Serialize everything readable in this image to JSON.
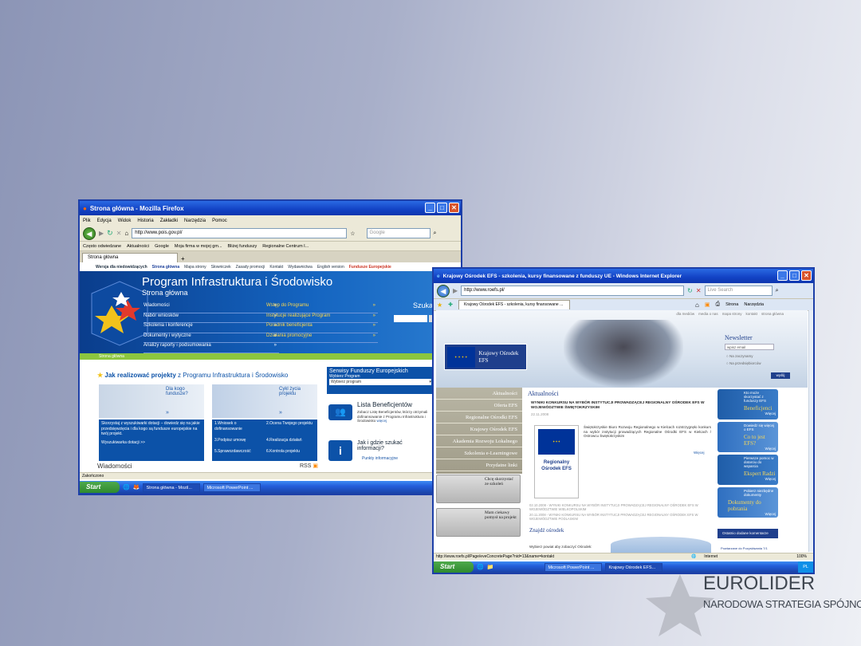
{
  "firefox": {
    "title": "Strona główna - Mozilla Firefox",
    "menu": [
      "Plik",
      "Edycja",
      "Widok",
      "Historia",
      "Zakładki",
      "Narzędzia",
      "Pomoc"
    ],
    "url": "http://www.pois.gov.pl/",
    "search_placeholder": "Google",
    "bookmarks": [
      "Często odwiedzane",
      "Aktualności",
      "Google",
      "Moja firma w mojej gm...",
      "Bliżej funduszy",
      "Regionalne Centrum I..."
    ],
    "tab": "Strona główna",
    "status": "Zakończono",
    "page": {
      "toplinks": [
        "Wersja dla niedowidzących",
        "Strona główna",
        "Mapa strony",
        "Słowniczek",
        "Zasady promocji",
        "Kontakt",
        "Wydawnictwa",
        "English version",
        "Fundusze Europejskie"
      ],
      "title": "Program Infrastruktura i Środowisko",
      "subtitle": "Strona główna",
      "menu_left": [
        "Wiadomości",
        "Nabór wniosków",
        "Szkolenia i konferencje",
        "Dokumenty i wytyczne",
        "Analizy raporty i podsumowania"
      ],
      "menu_right": [
        "Wstęp do Programu",
        "Instytucje realizujące Program",
        "Poradnik beneficjenta",
        "Działania promocyjne"
      ],
      "search_label": "Szukaj",
      "breadcrumb": "Strona główna",
      "howto_title": "Jak realizować projekty",
      "howto_suffix": "z Programu Infrastruktura i Środowisko",
      "card1_title": "Dla kogo fundusze?",
      "card2_title": "Cykl życia projektu",
      "card1_text": "Skorzystaj z wyszukiwarki dotacji – dowiedz się na jakie przedsięwzięcia i dla kogo są fundusze europejskie na twój projekt.",
      "card1_link": "Wyszukiwarka dotacji >>",
      "card2_steps": [
        "1.Wniosek o dofinansowanie",
        "2.Ocena Twojego projektu",
        "3.Podpisz umowę",
        "4.Realizacja działań",
        "5.Sprawozdawczość",
        "6.Kontrola projektu"
      ],
      "serwisy_title": "Serwisy Funduszy Europejskich",
      "serwisy_label": "Wybierz Program",
      "serwisy_select": "Wybierz program",
      "lista_title": "Lista Beneficjentów",
      "lista_text": "Zobacz Listę Beneficjentów, którzy otrzymali dofinansowanie z Programu Infrastruktura i Środowisko",
      "lista_more": "więcej",
      "info_title": "Jak i gdzie szukać informacji?",
      "info_link": "Punkty informacyjne",
      "news_label": "Wiadomości",
      "rss": "RSS"
    },
    "taskbar": {
      "start": "Start",
      "tasks": [
        "Strona główna - Mozil...",
        "Microsoft PowerPoint ..."
      ],
      "tray": "PL"
    }
  },
  "ie": {
    "title": "Krajowy Ośrodek EFS - szkolenia, kursy finansowane z funduszy UE - Windows Internet Explorer",
    "url": "http://www.roefs.pl/",
    "search_placeholder": "Live Search",
    "tab": "Krajowy Ośrodek EFS - szkolenia, kursy finansowane ...",
    "toolbar": [
      "Strona",
      "Narzędzia"
    ],
    "status_url": "http://www.roefs.pl/Page/eveConcretePage?nid=13&name=kontakt",
    "status_zone": "Internet",
    "zoom": "100%",
    "page": {
      "toplinks": [
        "dla mediów",
        "media o nas",
        "mapa strony",
        "kontakt",
        "strona główna"
      ],
      "logo": "Krajowy Ośrodek EFS",
      "newsletter_title": "Newsletter",
      "newsletter_placeholder": "wpisz email",
      "newsletter_opts": [
        "Na zaczynamy",
        "Na przedsiębiorców"
      ],
      "newsletter_btn": "wyślij",
      "side_menu": [
        "Aktualności",
        "Oferta EFS",
        "Regionalne Ośrodki EFS",
        "Krajowy Ośrodek EFS",
        "Akademia Rozwoju Lokalnego",
        "Szkolenia e-Learningowe",
        "Przydatne linki"
      ],
      "side_boxes": [
        "Chcę skorzystać ze szkoleń",
        "Mam ciekawy pomysł na projekt"
      ],
      "news_title": "Aktualności",
      "news_headline": "WYNIKI KONKURSU NA WYBÓR INSTYTUCJI PROWADZĄCEJ REGIONALNY OŚRODEK EFS W WOJEWÓDZTWIE ŚWIĘTOKRZYSKIM",
      "news_date": "22.11.2008",
      "news_body": "Świętokrzyskie Biuro Rozwoju Regionalnego w Kielcach rozstrzygnęło konkurs na wybór instytucji prowadzących Regionalne Ośrodki EFS w Kielcach / Ostrowcu Świętokrzyskim",
      "news_more": "Więcej",
      "badge": "Regionalny Ośrodek EFS",
      "older": [
        "02.10.2008 - WYNIKI KONKURSU NA WYBÓR INSTYTUCJI PROWADZĄCEJ REGIONALNY OŚRODEK EFS W WOJEWÓDZTWIE WIELKOPOLSKIM",
        "20.11.2008 - WYNIKI KONKURSU NA WYBÓR INSTYTUCJI PROWADZĄCEJ REGIONALNY OŚRODEK EFS W WOJEWÓDZTWIE PODLASKIM"
      ],
      "find_title": "Znajdź ośrodek",
      "find_text": "Wybierz powiat aby zobaczyć Ośrodek:",
      "right_boxes": [
        {
          "small": "Kto może skorzystać z funduszy EFS",
          "title": "Beneficjenci",
          "more": "Więcej"
        },
        {
          "small": "Dowiedz się więcej o EFS",
          "title": "Co to jest EFS?",
          "more": "Więcej"
        },
        {
          "small": "Pierwsze pomoc w dotarciu do wsparcia",
          "title": "Ekspert Radzi",
          "more": "Więcej"
        },
        {
          "small": "Pobierz niezbędne dokumenty",
          "title": "Dokumenty do pobrania",
          "more": "Więcej"
        }
      ],
      "comments_title": "Ostatnio dodane komentarze",
      "comments_item": "Powtarzane do Pozyskiwania 7/1"
    },
    "taskbar": {
      "start": "Start",
      "tasks": [
        "Microsoft PowerPoint ...",
        "Krajowy Ośrodek EFS..."
      ],
      "tray": "PL"
    }
  },
  "brand": {
    "name": "EUROLIDER",
    "tagline": "NARODOWA STRATEGIA SPÓJNOŚCI"
  }
}
